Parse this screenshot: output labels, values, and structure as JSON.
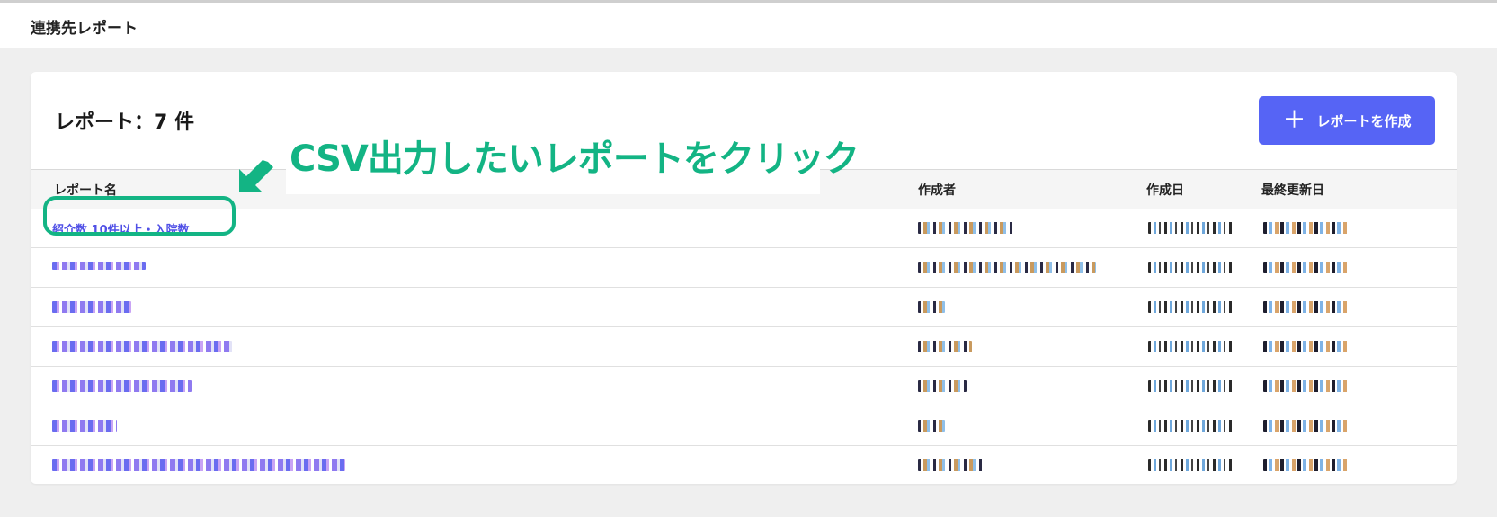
{
  "header": {
    "title": "連携先レポート"
  },
  "card": {
    "count_title": "レポート：7 件",
    "create_button": {
      "icon": "plus-icon",
      "label": "レポートを作成"
    }
  },
  "table": {
    "columns": [
      "レポート名",
      "作成者",
      "作成日",
      "最終更新日"
    ],
    "first_row_name": "紹介数 10件以上・入院数",
    "row_count": 7
  },
  "annotation": {
    "text": "CSV出力したいレポートをクリック",
    "color": "#13b484"
  },
  "colors": {
    "accent": "#5664f5",
    "link": "#5050e6",
    "annotation": "#13b484"
  }
}
